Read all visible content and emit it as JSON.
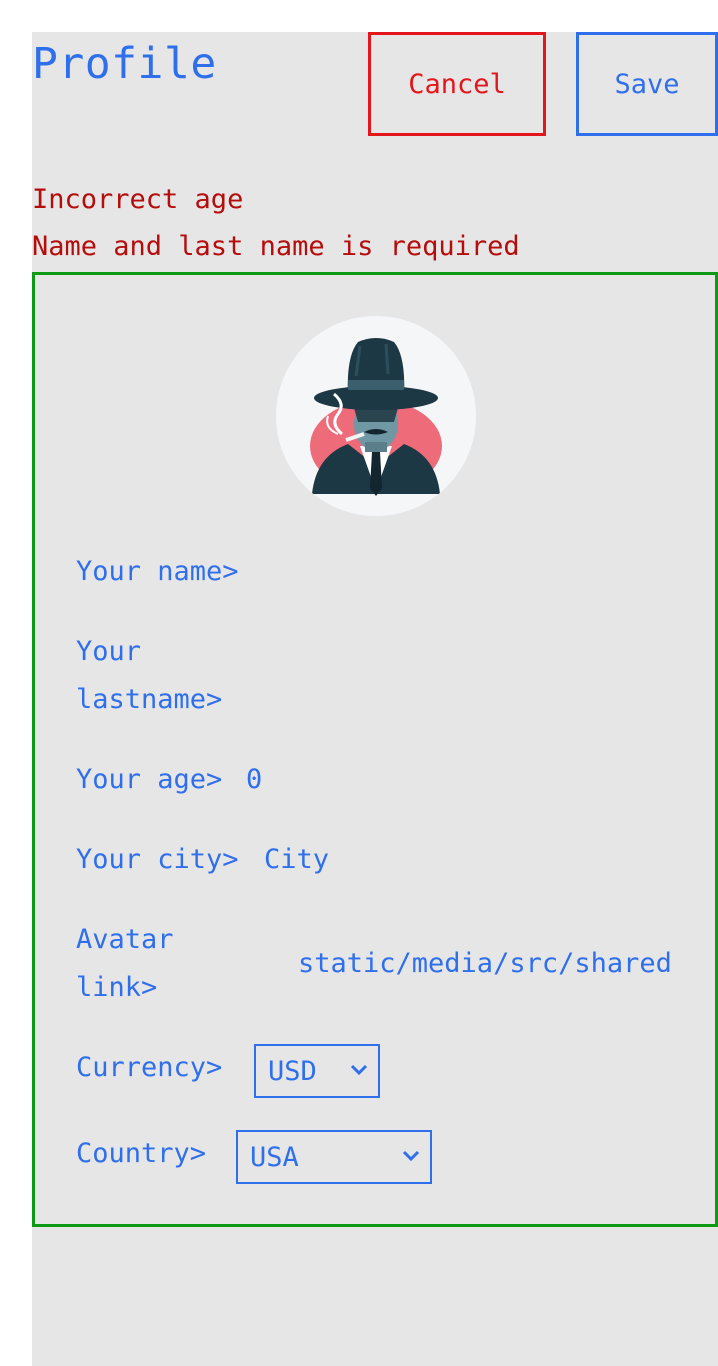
{
  "header": {
    "title": "Profile",
    "cancel_label": "Cancel",
    "save_label": "Save"
  },
  "errors": [
    "Incorrect age",
    "Name and last name is required"
  ],
  "form": {
    "avatar_icon": "spy-avatar",
    "name_label": "Your name>",
    "name_value": "",
    "lastname_label_1": "Your",
    "lastname_label_2": "lastname>",
    "lastname_value": "",
    "age_label": "Your age>",
    "age_value": "0",
    "city_label": "Your city>",
    "city_value": "City",
    "avatar_label_1": "Avatar",
    "avatar_label_2": "link>",
    "avatar_value": "static/media/src/shared",
    "currency_label": "Currency>",
    "currency_value": "USD",
    "country_label": "Country>",
    "country_value": "USA"
  },
  "colors": {
    "accent": "#2f6fec",
    "cancel": "#e3161c",
    "error": "#b50c0c",
    "card_border": "#0f9a15",
    "panel_bg": "#e6e6e6"
  }
}
